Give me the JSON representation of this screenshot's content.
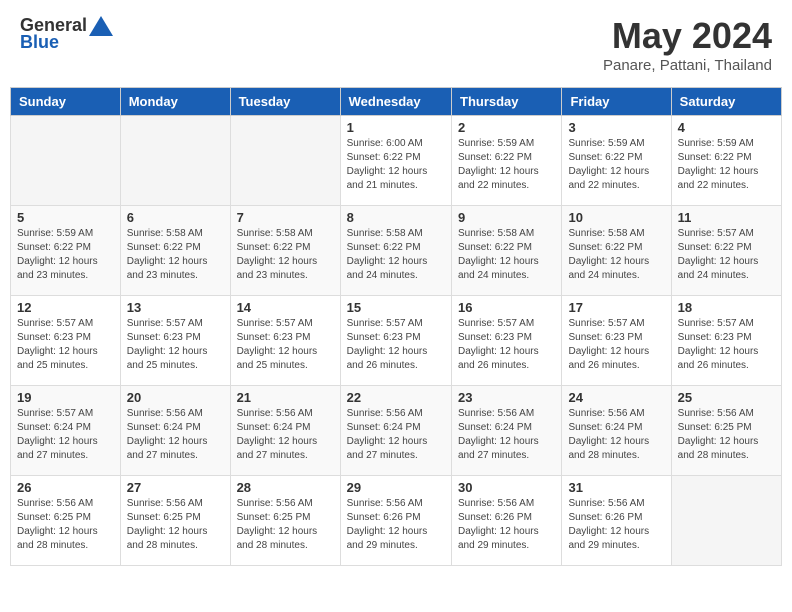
{
  "header": {
    "logo_general": "General",
    "logo_blue": "Blue",
    "month_title": "May 2024",
    "location": "Panare, Pattani, Thailand"
  },
  "weekdays": [
    "Sunday",
    "Monday",
    "Tuesday",
    "Wednesday",
    "Thursday",
    "Friday",
    "Saturday"
  ],
  "weeks": [
    [
      {
        "day": "",
        "info": ""
      },
      {
        "day": "",
        "info": ""
      },
      {
        "day": "",
        "info": ""
      },
      {
        "day": "1",
        "info": "Sunrise: 6:00 AM\nSunset: 6:22 PM\nDaylight: 12 hours\nand 21 minutes."
      },
      {
        "day": "2",
        "info": "Sunrise: 5:59 AM\nSunset: 6:22 PM\nDaylight: 12 hours\nand 22 minutes."
      },
      {
        "day": "3",
        "info": "Sunrise: 5:59 AM\nSunset: 6:22 PM\nDaylight: 12 hours\nand 22 minutes."
      },
      {
        "day": "4",
        "info": "Sunrise: 5:59 AM\nSunset: 6:22 PM\nDaylight: 12 hours\nand 22 minutes."
      }
    ],
    [
      {
        "day": "5",
        "info": "Sunrise: 5:59 AM\nSunset: 6:22 PM\nDaylight: 12 hours\nand 23 minutes."
      },
      {
        "day": "6",
        "info": "Sunrise: 5:58 AM\nSunset: 6:22 PM\nDaylight: 12 hours\nand 23 minutes."
      },
      {
        "day": "7",
        "info": "Sunrise: 5:58 AM\nSunset: 6:22 PM\nDaylight: 12 hours\nand 23 minutes."
      },
      {
        "day": "8",
        "info": "Sunrise: 5:58 AM\nSunset: 6:22 PM\nDaylight: 12 hours\nand 24 minutes."
      },
      {
        "day": "9",
        "info": "Sunrise: 5:58 AM\nSunset: 6:22 PM\nDaylight: 12 hours\nand 24 minutes."
      },
      {
        "day": "10",
        "info": "Sunrise: 5:58 AM\nSunset: 6:22 PM\nDaylight: 12 hours\nand 24 minutes."
      },
      {
        "day": "11",
        "info": "Sunrise: 5:57 AM\nSunset: 6:22 PM\nDaylight: 12 hours\nand 24 minutes."
      }
    ],
    [
      {
        "day": "12",
        "info": "Sunrise: 5:57 AM\nSunset: 6:23 PM\nDaylight: 12 hours\nand 25 minutes."
      },
      {
        "day": "13",
        "info": "Sunrise: 5:57 AM\nSunset: 6:23 PM\nDaylight: 12 hours\nand 25 minutes."
      },
      {
        "day": "14",
        "info": "Sunrise: 5:57 AM\nSunset: 6:23 PM\nDaylight: 12 hours\nand 25 minutes."
      },
      {
        "day": "15",
        "info": "Sunrise: 5:57 AM\nSunset: 6:23 PM\nDaylight: 12 hours\nand 26 minutes."
      },
      {
        "day": "16",
        "info": "Sunrise: 5:57 AM\nSunset: 6:23 PM\nDaylight: 12 hours\nand 26 minutes."
      },
      {
        "day": "17",
        "info": "Sunrise: 5:57 AM\nSunset: 6:23 PM\nDaylight: 12 hours\nand 26 minutes."
      },
      {
        "day": "18",
        "info": "Sunrise: 5:57 AM\nSunset: 6:23 PM\nDaylight: 12 hours\nand 26 minutes."
      }
    ],
    [
      {
        "day": "19",
        "info": "Sunrise: 5:57 AM\nSunset: 6:24 PM\nDaylight: 12 hours\nand 27 minutes."
      },
      {
        "day": "20",
        "info": "Sunrise: 5:56 AM\nSunset: 6:24 PM\nDaylight: 12 hours\nand 27 minutes."
      },
      {
        "day": "21",
        "info": "Sunrise: 5:56 AM\nSunset: 6:24 PM\nDaylight: 12 hours\nand 27 minutes."
      },
      {
        "day": "22",
        "info": "Sunrise: 5:56 AM\nSunset: 6:24 PM\nDaylight: 12 hours\nand 27 minutes."
      },
      {
        "day": "23",
        "info": "Sunrise: 5:56 AM\nSunset: 6:24 PM\nDaylight: 12 hours\nand 27 minutes."
      },
      {
        "day": "24",
        "info": "Sunrise: 5:56 AM\nSunset: 6:24 PM\nDaylight: 12 hours\nand 28 minutes."
      },
      {
        "day": "25",
        "info": "Sunrise: 5:56 AM\nSunset: 6:25 PM\nDaylight: 12 hours\nand 28 minutes."
      }
    ],
    [
      {
        "day": "26",
        "info": "Sunrise: 5:56 AM\nSunset: 6:25 PM\nDaylight: 12 hours\nand 28 minutes."
      },
      {
        "day": "27",
        "info": "Sunrise: 5:56 AM\nSunset: 6:25 PM\nDaylight: 12 hours\nand 28 minutes."
      },
      {
        "day": "28",
        "info": "Sunrise: 5:56 AM\nSunset: 6:25 PM\nDaylight: 12 hours\nand 28 minutes."
      },
      {
        "day": "29",
        "info": "Sunrise: 5:56 AM\nSunset: 6:26 PM\nDaylight: 12 hours\nand 29 minutes."
      },
      {
        "day": "30",
        "info": "Sunrise: 5:56 AM\nSunset: 6:26 PM\nDaylight: 12 hours\nand 29 minutes."
      },
      {
        "day": "31",
        "info": "Sunrise: 5:56 AM\nSunset: 6:26 PM\nDaylight: 12 hours\nand 29 minutes."
      },
      {
        "day": "",
        "info": ""
      }
    ]
  ]
}
